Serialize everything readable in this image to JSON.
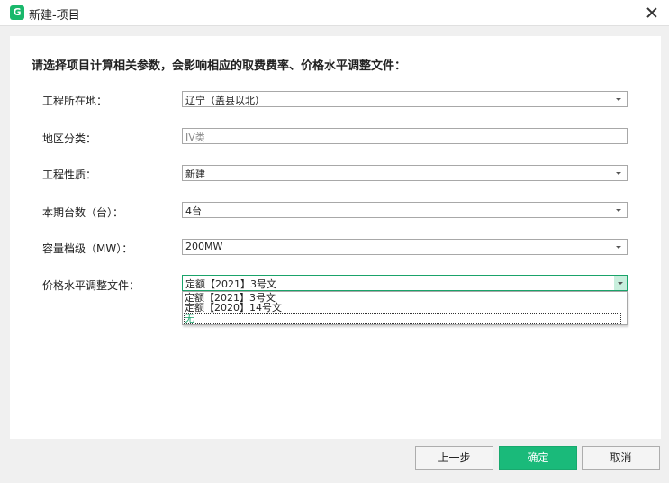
{
  "window": {
    "title": "新建-项目"
  },
  "instruction": "请选择项目计算相关参数，会影响相应的取费费率、价格水平调整文件：",
  "fields": {
    "location": {
      "label": "工程所在地：",
      "value": "辽宁（盖县以北）"
    },
    "region": {
      "label": "地区分类：",
      "value": "IV类"
    },
    "nature": {
      "label": "工程性质：",
      "value": "新建"
    },
    "units": {
      "label": "本期台数（台）：",
      "value": "4台"
    },
    "capacity": {
      "label": "容量档级（MW）：",
      "value": "200MW"
    },
    "price_doc": {
      "label": "价格水平调整文件：",
      "value": "定额【2021】3号文",
      "options": [
        "定额【2021】3号文",
        "定额【2020】14号文",
        "无"
      ]
    }
  },
  "buttons": {
    "prev": "上一步",
    "ok": "确定",
    "cancel": "取消"
  },
  "colors": {
    "accent": "#1aba7a",
    "logo": "#19b86b"
  }
}
